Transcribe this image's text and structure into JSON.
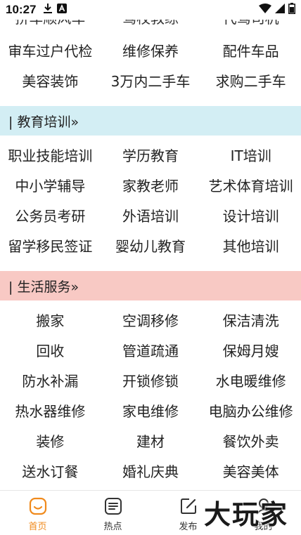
{
  "status_bar": {
    "time": "10:27",
    "icons": [
      "download-icon",
      "app-notification-icon",
      "wifi-icon",
      "signal-icon",
      "battery-icon"
    ]
  },
  "top_partial_row": [
    "拼车顺风车",
    "驾校教练",
    "代驾司机"
  ],
  "car_rows": [
    [
      "审车过户代检",
      "维修保养",
      "配件车品"
    ],
    [
      "美容装饰",
      "3万内二手车",
      "求购二手车"
    ]
  ],
  "education": {
    "header": "| 教育培训»",
    "rows": [
      [
        "职业技能培训",
        "学历教育",
        "IT培训"
      ],
      [
        "中小学辅导",
        "家教老师",
        "艺术体育培训"
      ],
      [
        "公务员考研",
        "外语培训",
        "设计培训"
      ],
      [
        "留学移民签证",
        "婴幼儿教育",
        "其他培训"
      ]
    ]
  },
  "life_services": {
    "header": "| 生活服务»",
    "rows": [
      [
        "搬家",
        "空调移修",
        "保洁清洗"
      ],
      [
        "回收",
        "管道疏通",
        "保姆月嫂"
      ],
      [
        "防水补漏",
        "开锁修锁",
        "水电暖维修"
      ],
      [
        "热水器维修",
        "家电维修",
        "电脑办公维修"
      ],
      [
        "装修",
        "建材",
        "餐饮外卖"
      ],
      [
        "送水订餐",
        "婚礼庆典",
        "美容美体"
      ]
    ]
  },
  "tabbar": {
    "home": "首页",
    "hot": "热点",
    "publish": "发布",
    "mine": "我的"
  },
  "watermark": "大玩家",
  "colors": {
    "accent": "#f08a1c",
    "education_header_bg": "#d3eef4",
    "life_header_bg": "#f8c9c4"
  }
}
